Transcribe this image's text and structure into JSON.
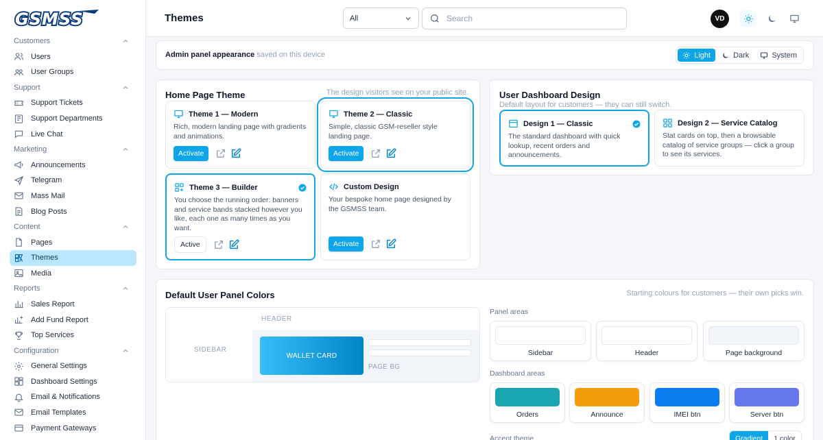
{
  "brand": {
    "logo_text": "GSMSS"
  },
  "sidebar": {
    "sections": [
      {
        "label": "Customers",
        "items": [
          {
            "label": "Users",
            "icon": "users-icon"
          },
          {
            "label": "User Groups",
            "icon": "user-groups-icon"
          }
        ]
      },
      {
        "label": "Support",
        "items": [
          {
            "label": "Support Tickets",
            "icon": "ticket-icon"
          },
          {
            "label": "Support Departments",
            "icon": "departments-icon"
          },
          {
            "label": "Live Chat",
            "icon": "chat-icon"
          }
        ]
      },
      {
        "label": "Marketing",
        "items": [
          {
            "label": "Announcements",
            "icon": "megaphone-icon"
          },
          {
            "label": "Telegram",
            "icon": "send-icon"
          },
          {
            "label": "Mass Mail",
            "icon": "mail-icon"
          },
          {
            "label": "Blog Posts",
            "icon": "blog-icon"
          }
        ]
      },
      {
        "label": "Content",
        "items": [
          {
            "label": "Pages",
            "icon": "page-icon"
          },
          {
            "label": "Themes",
            "icon": "themes-icon",
            "active": true
          },
          {
            "label": "Media",
            "icon": "image-icon"
          }
        ]
      },
      {
        "label": "Reports",
        "items": [
          {
            "label": "Sales Report",
            "icon": "bar-chart-icon"
          },
          {
            "label": "Add Fund Report",
            "icon": "add-fund-icon"
          },
          {
            "label": "Top Services",
            "icon": "trophy-icon"
          }
        ]
      },
      {
        "label": "Configuration",
        "items": [
          {
            "label": "General Settings",
            "icon": "gear-icon"
          },
          {
            "label": "Dashboard Settings",
            "icon": "dashboard-icon"
          },
          {
            "label": "Email & Notifications",
            "icon": "bell-icon"
          },
          {
            "label": "Email Templates",
            "icon": "template-icon"
          },
          {
            "label": "Payment Gateways",
            "icon": "card-icon"
          }
        ]
      }
    ]
  },
  "header": {
    "title": "Themes",
    "filter": {
      "value": "All"
    },
    "search": {
      "placeholder": "Search",
      "value": ""
    },
    "avatar": "VD"
  },
  "appearance": {
    "title": "Admin panel appearance",
    "note": "saved on this device",
    "options": [
      {
        "label": "Light",
        "selected": true
      },
      {
        "label": "Dark"
      },
      {
        "label": "System"
      }
    ]
  },
  "home_theme": {
    "title": "Home Page Theme",
    "subtitle": "The design visitors see on your public site.",
    "cards": [
      {
        "title": "Theme 1 — Modern",
        "desc": "Rich, modern landing page with gradients and animations.",
        "action": "Activate"
      },
      {
        "title": "Theme 2 — Classic",
        "desc": "Simple, classic GSM-reseller style landing page.",
        "action": "Activate"
      },
      {
        "title": "Theme 3 — Builder",
        "desc": "You choose the running order: banners and service bands stacked however you like, each one as many times as you want.",
        "action": "Active"
      },
      {
        "title": "Custom Design",
        "desc": "Your bespoke home page designed by the GSMSS team.",
        "action": "Activate"
      }
    ]
  },
  "dashboard_design": {
    "title": "User Dashboard Design",
    "subtitle": "Default layout for customers — they can still switch.",
    "cards": [
      {
        "title": "Design 1 — Classic",
        "desc": "The standard dashboard with quick lookup, recent orders and announcements.",
        "selected": true
      },
      {
        "title": "Design 2 — Service Catalog",
        "desc": "Stat cards on top, then a browsable catalog of service groups — click a group to see its services."
      }
    ]
  },
  "panel_colors": {
    "title": "Default User Panel Colors",
    "subtitle": "Starting colours for customers — their own picks win.",
    "preview": {
      "header": "HEADER",
      "sidebar": "SIDEBAR",
      "wallet": "WALLET CARD",
      "page_bg": "PAGE BG"
    },
    "panel_areas_label": "Panel areas",
    "panel_areas": [
      {
        "label": "Sidebar",
        "color": "#ffffff"
      },
      {
        "label": "Header",
        "color": "#ffffff"
      },
      {
        "label": "Page background",
        "color": "#f1f5f9"
      }
    ],
    "dashboard_areas_label": "Dashboard areas",
    "dashboard_areas": [
      {
        "label": "Orders",
        "color": "#1aa5b0"
      },
      {
        "label": "Announce",
        "color": "#f59e0b"
      },
      {
        "label": "IMEI btn",
        "color": "#0b7cf0"
      },
      {
        "label": "Server btn",
        "color": "#6577ea"
      }
    ],
    "accent_label": "Accent theme",
    "accent_options": [
      {
        "label": "Gradient",
        "selected": true
      },
      {
        "label": "1 color"
      }
    ]
  }
}
